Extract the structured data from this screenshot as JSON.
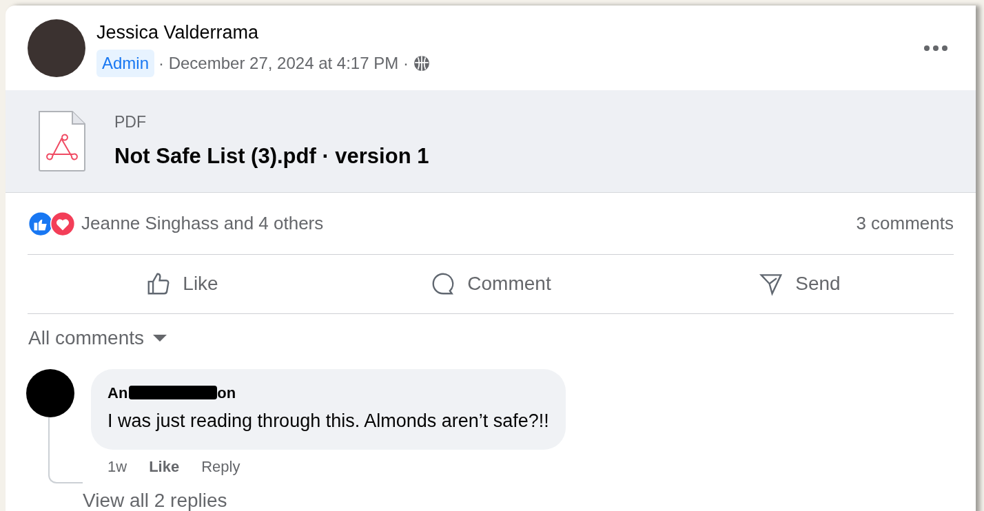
{
  "post": {
    "author": "Jessica Valderrama",
    "badge": "Admin",
    "timestamp": "· December 27, 2024 at 4:17 PM ·"
  },
  "attachment": {
    "type_label": "PDF",
    "file_name": "Not Safe List (3).pdf · version 1"
  },
  "reactions": {
    "summary": "Jeanne Singhass and 4 others",
    "comment_count": "3 comments"
  },
  "actions": [
    {
      "kind": "like",
      "label": "Like"
    },
    {
      "kind": "comment",
      "label": "Comment"
    },
    {
      "kind": "send",
      "label": "Send"
    }
  ],
  "comments_filter": "All comments",
  "comments": [
    {
      "author_start": "An",
      "author_end": "on",
      "text": "I was just reading through this. Almonds aren’t safe?!!",
      "time": "1w",
      "like": "Like",
      "reply": "Reply",
      "replies_link": "View all 2 replies"
    }
  ]
}
